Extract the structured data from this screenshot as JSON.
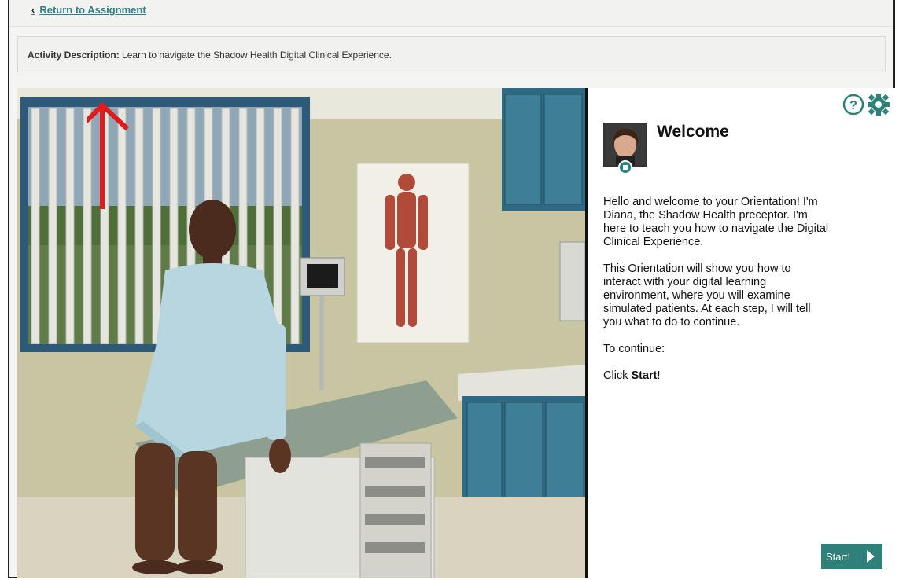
{
  "topbar": {
    "back_label": "Return to Assignment",
    "back_chevron": "‹"
  },
  "activity": {
    "label": "Activity Description:",
    "text": "Learn to navigate the Shadow Health Digital Clinical Experience."
  },
  "panel": {
    "title": "Welcome",
    "paragraphs": [
      "Hello and welcome to your Orientation! I'm Diana, the Shadow Health preceptor. I'm here to teach you how to navigate the Digital Clinical Experience.",
      "This Orientation will show you how to interact with your digital learning environment, where you will examine simulated patients. At each step, I will tell you what to do to continue.",
      "To continue:"
    ],
    "click_prefix": "Click ",
    "click_bold": "Start",
    "click_suffix": "!",
    "start_label": "Start!"
  },
  "icons": {
    "help": "help-icon",
    "settings": "gear-icon",
    "back": "chevron-left-icon"
  },
  "colors": {
    "accent": "#2e807b",
    "link": "#2f7f86",
    "annotation": "#e11b1b"
  }
}
